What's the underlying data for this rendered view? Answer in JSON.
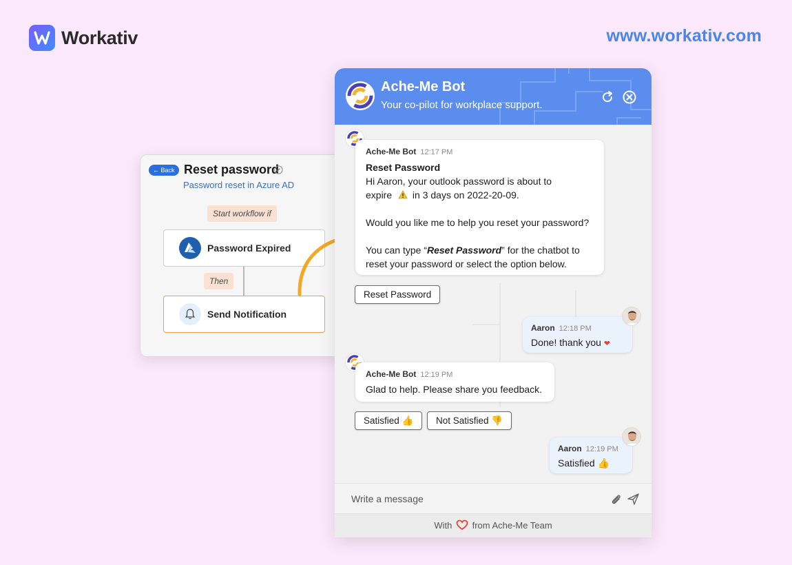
{
  "brand": {
    "name": "Workativ",
    "url": "www.workativ.com",
    "accent": "#4a86e8"
  },
  "workflow": {
    "back_label": "← Back",
    "title": "Reset password",
    "subtitle": "Password reset in Azure AD",
    "start_tag": "Start workflow if",
    "then_tag": "Then",
    "nodes": [
      {
        "label": "Password Expired",
        "icon": "azure-icon"
      },
      {
        "label": "Send Notification",
        "icon": "bell-icon"
      }
    ]
  },
  "chat": {
    "bot_name": "Ache-Me Bot",
    "tagline": "Your co-pilot for workplace support.",
    "header_color": "#5b8def",
    "messages": [
      {
        "sender": "Ache-Me Bot",
        "time": "12:17 PM",
        "title": "Reset Password",
        "line1": "Hi Aaron, your outlook password is about to",
        "line2a": "expire",
        "line2b": "in 3 days on 2022-20-09.",
        "line3": "Would you like me to help you reset your password?",
        "line4a": "You can type “",
        "line4b": "Reset Password",
        "line4c": "” for the chatbot to",
        "line5": "reset your password or select the option below."
      },
      {
        "sender": "Aaron",
        "time": "12:18 PM",
        "text": "Done! thank you",
        "emoji": "❤"
      },
      {
        "sender": "Ache-Me Bot",
        "time": "12:19 PM",
        "text": "Glad to help. Please share you feedback."
      },
      {
        "sender": "Aaron",
        "time": "12:19 PM",
        "text": "Satisfied 👍"
      }
    ],
    "options": {
      "reset": "Reset Password",
      "satisfied": "Satisfied 👍",
      "not_satisfied": "Not Satisfied 👎"
    },
    "input_placeholder": "Write a message",
    "footer_prefix": "With",
    "footer_suffix": "from Ache-Me Team"
  }
}
